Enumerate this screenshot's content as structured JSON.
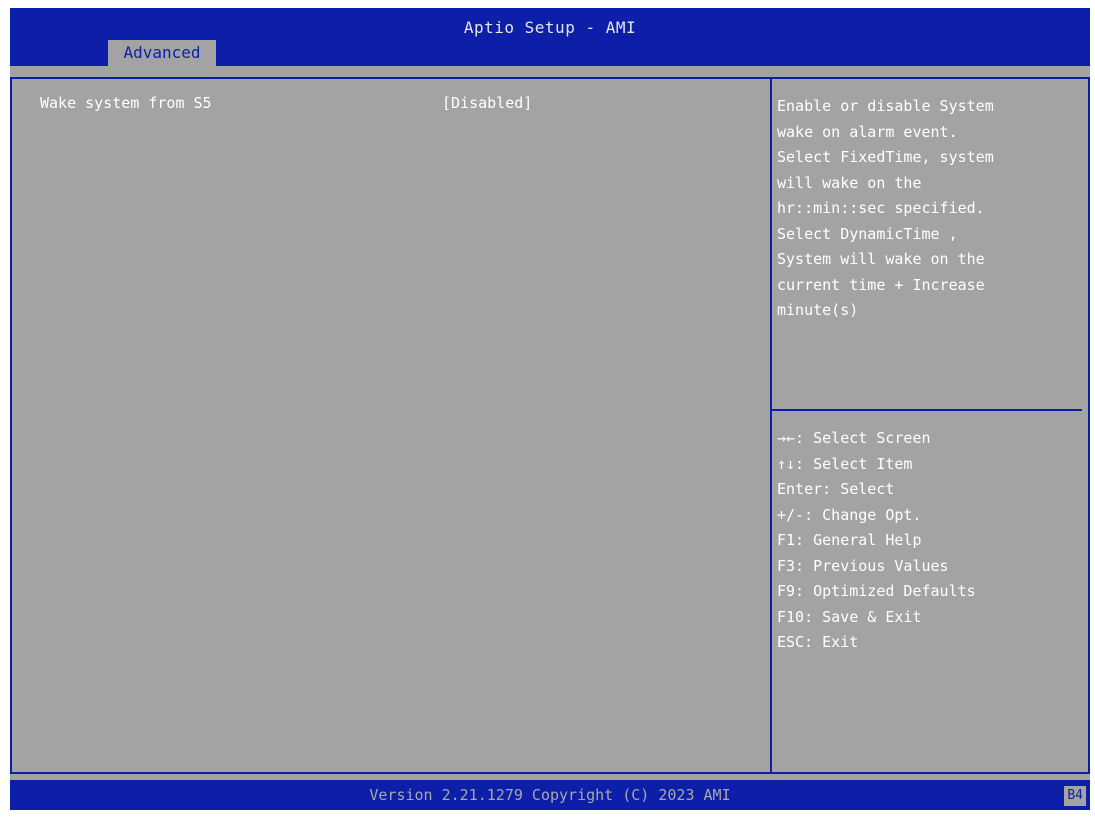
{
  "app": {
    "title": "Aptio Setup - AMI",
    "colors": {
      "accent": "#0d1ea8",
      "background": "#a3a3a3",
      "text": "#ffffff"
    }
  },
  "tabs": [
    {
      "label": "Advanced",
      "active": true
    }
  ],
  "main": {
    "options": [
      {
        "label": "Wake system from S5",
        "value": "[Disabled]"
      }
    ]
  },
  "help": {
    "lines": [
      "Enable or disable System",
      "wake on alarm event.",
      "Select FixedTime, system",
      "will wake on the",
      "hr::min::sec specified.",
      "Select DynamicTime ,",
      "System will wake on the",
      "current time + Increase",
      "minute(s)"
    ]
  },
  "keys": [
    "→←: Select Screen",
    "↑↓: Select Item",
    "Enter: Select",
    "+/-: Change Opt.",
    "F1: General Help",
    "F3: Previous Values",
    "F9: Optimized Defaults",
    "F10: Save & Exit",
    "ESC: Exit"
  ],
  "footer": {
    "version": "Version 2.21.1279 Copyright (C) 2023 AMI",
    "badge": "B4"
  }
}
